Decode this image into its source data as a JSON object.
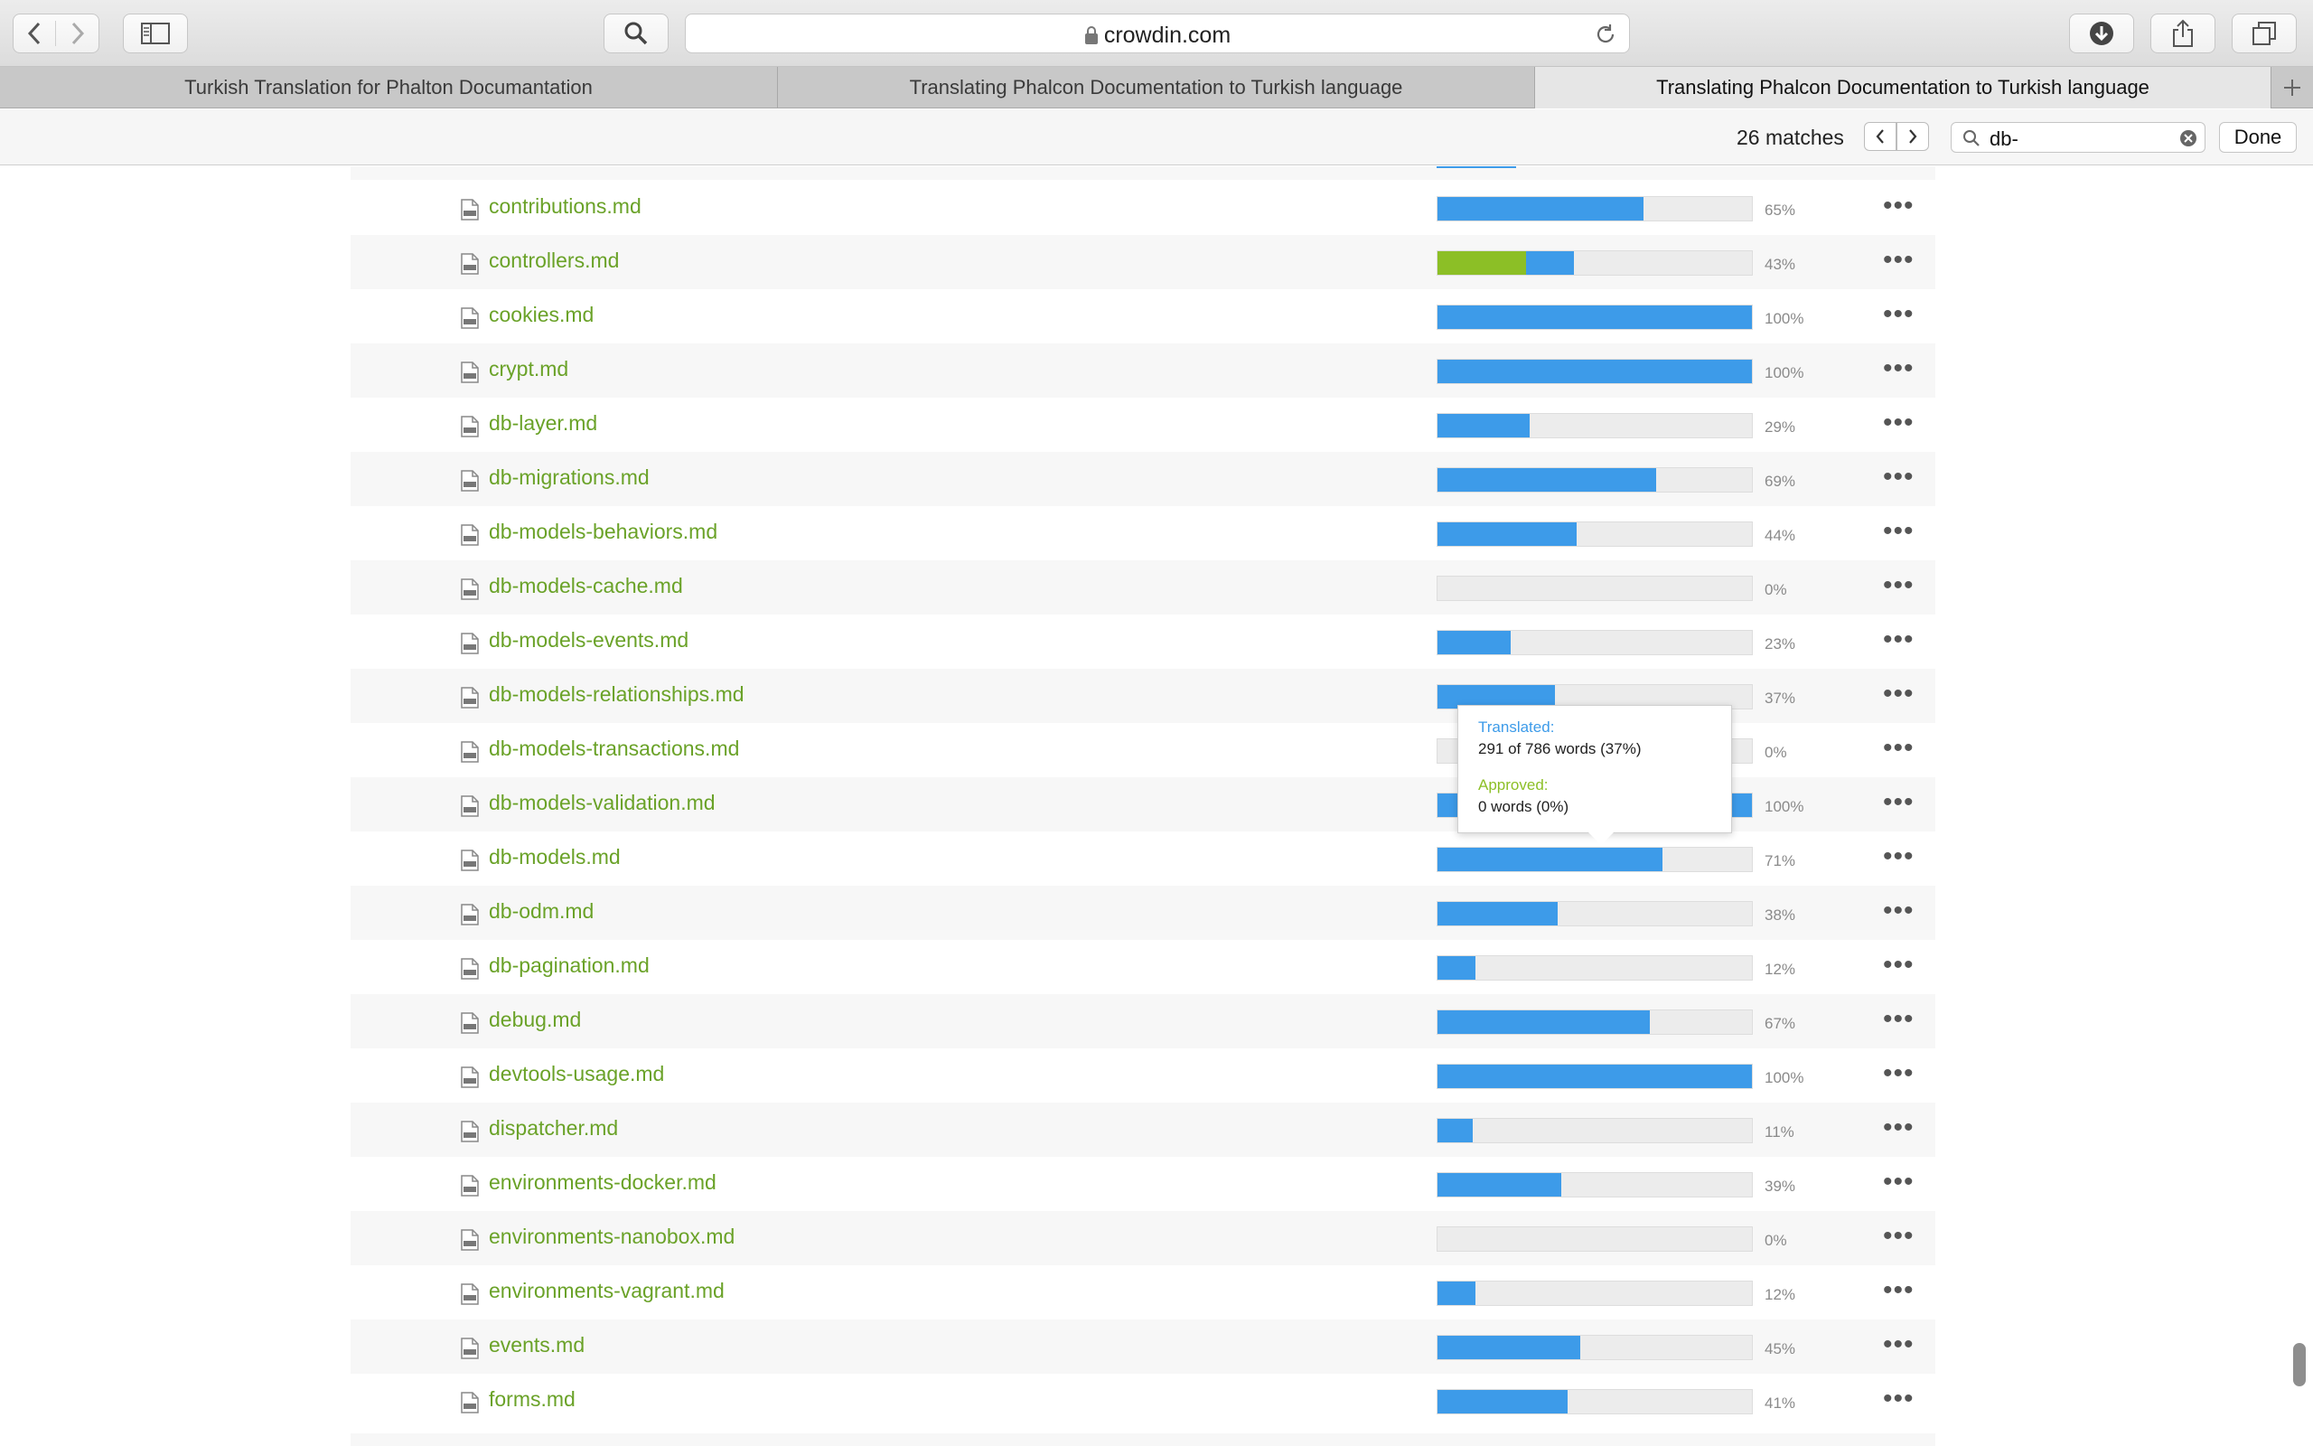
{
  "browser": {
    "url": "crowdin.com",
    "tabs": [
      {
        "label": "Turkish Translation for Phalton Documantation",
        "active": false
      },
      {
        "label": "Translating Phalcon Documentation to Turkish language",
        "active": false
      },
      {
        "label": "Translating Phalcon Documentation to Turkish language",
        "active": true
      }
    ]
  },
  "find": {
    "matches": "26 matches",
    "query": "db-",
    "done_label": "Done"
  },
  "files": [
    {
      "name": "contributions.md",
      "translated": 65,
      "approved": 0,
      "pct": "65%"
    },
    {
      "name": "controllers.md",
      "translated": 43,
      "approved": 28,
      "pct": "43%"
    },
    {
      "name": "cookies.md",
      "translated": 100,
      "approved": 0,
      "pct": "100%"
    },
    {
      "name": "crypt.md",
      "translated": 100,
      "approved": 0,
      "pct": "100%"
    },
    {
      "name": "db-layer.md",
      "translated": 29,
      "approved": 0,
      "pct": "29%"
    },
    {
      "name": "db-migrations.md",
      "translated": 69,
      "approved": 0,
      "pct": "69%"
    },
    {
      "name": "db-models-behaviors.md",
      "translated": 44,
      "approved": 0,
      "pct": "44%"
    },
    {
      "name": "db-models-cache.md",
      "translated": 0,
      "approved": 0,
      "pct": "0%"
    },
    {
      "name": "db-models-events.md",
      "translated": 23,
      "approved": 0,
      "pct": "23%"
    },
    {
      "name": "db-models-relationships.md",
      "translated": 37,
      "approved": 0,
      "pct": "37%"
    },
    {
      "name": "db-models-transactions.md",
      "translated": 0,
      "approved": 0,
      "pct": "0%"
    },
    {
      "name": "db-models-validation.md",
      "translated": 100,
      "approved": 0,
      "pct": "100%"
    },
    {
      "name": "db-models.md",
      "translated": 71,
      "approved": 0,
      "pct": "71%"
    },
    {
      "name": "db-odm.md",
      "translated": 38,
      "approved": 0,
      "pct": "38%"
    },
    {
      "name": "db-pagination.md",
      "translated": 12,
      "approved": 0,
      "pct": "12%"
    },
    {
      "name": "debug.md",
      "translated": 67,
      "approved": 0,
      "pct": "67%"
    },
    {
      "name": "devtools-usage.md",
      "translated": 100,
      "approved": 0,
      "pct": "100%"
    },
    {
      "name": "dispatcher.md",
      "translated": 11,
      "approved": 0,
      "pct": "11%"
    },
    {
      "name": "environments-docker.md",
      "translated": 39,
      "approved": 0,
      "pct": "39%"
    },
    {
      "name": "environments-nanobox.md",
      "translated": 0,
      "approved": 0,
      "pct": "0%"
    },
    {
      "name": "environments-vagrant.md",
      "translated": 12,
      "approved": 0,
      "pct": "12%"
    },
    {
      "name": "events.md",
      "translated": 45,
      "approved": 0,
      "pct": "45%"
    },
    {
      "name": "forms.md",
      "translated": 41,
      "approved": 0,
      "pct": "41%"
    }
  ],
  "tooltip": {
    "translated_label": "Translated:",
    "translated_value": "291 of 786 words (37%)",
    "approved_label": "Approved:",
    "approved_value": "0 words (0%)"
  },
  "colors": {
    "translated": "#3d9be9",
    "approved": "#8cbf26",
    "filename": "#6aa228"
  },
  "icons": [
    "back-icon",
    "forward-icon",
    "sidebar-icon",
    "search-icon",
    "lock-icon",
    "reload-icon",
    "download-icon",
    "share-icon",
    "tabs-icon",
    "new-tab-icon",
    "file-icon",
    "more-icon",
    "clear-icon"
  ]
}
